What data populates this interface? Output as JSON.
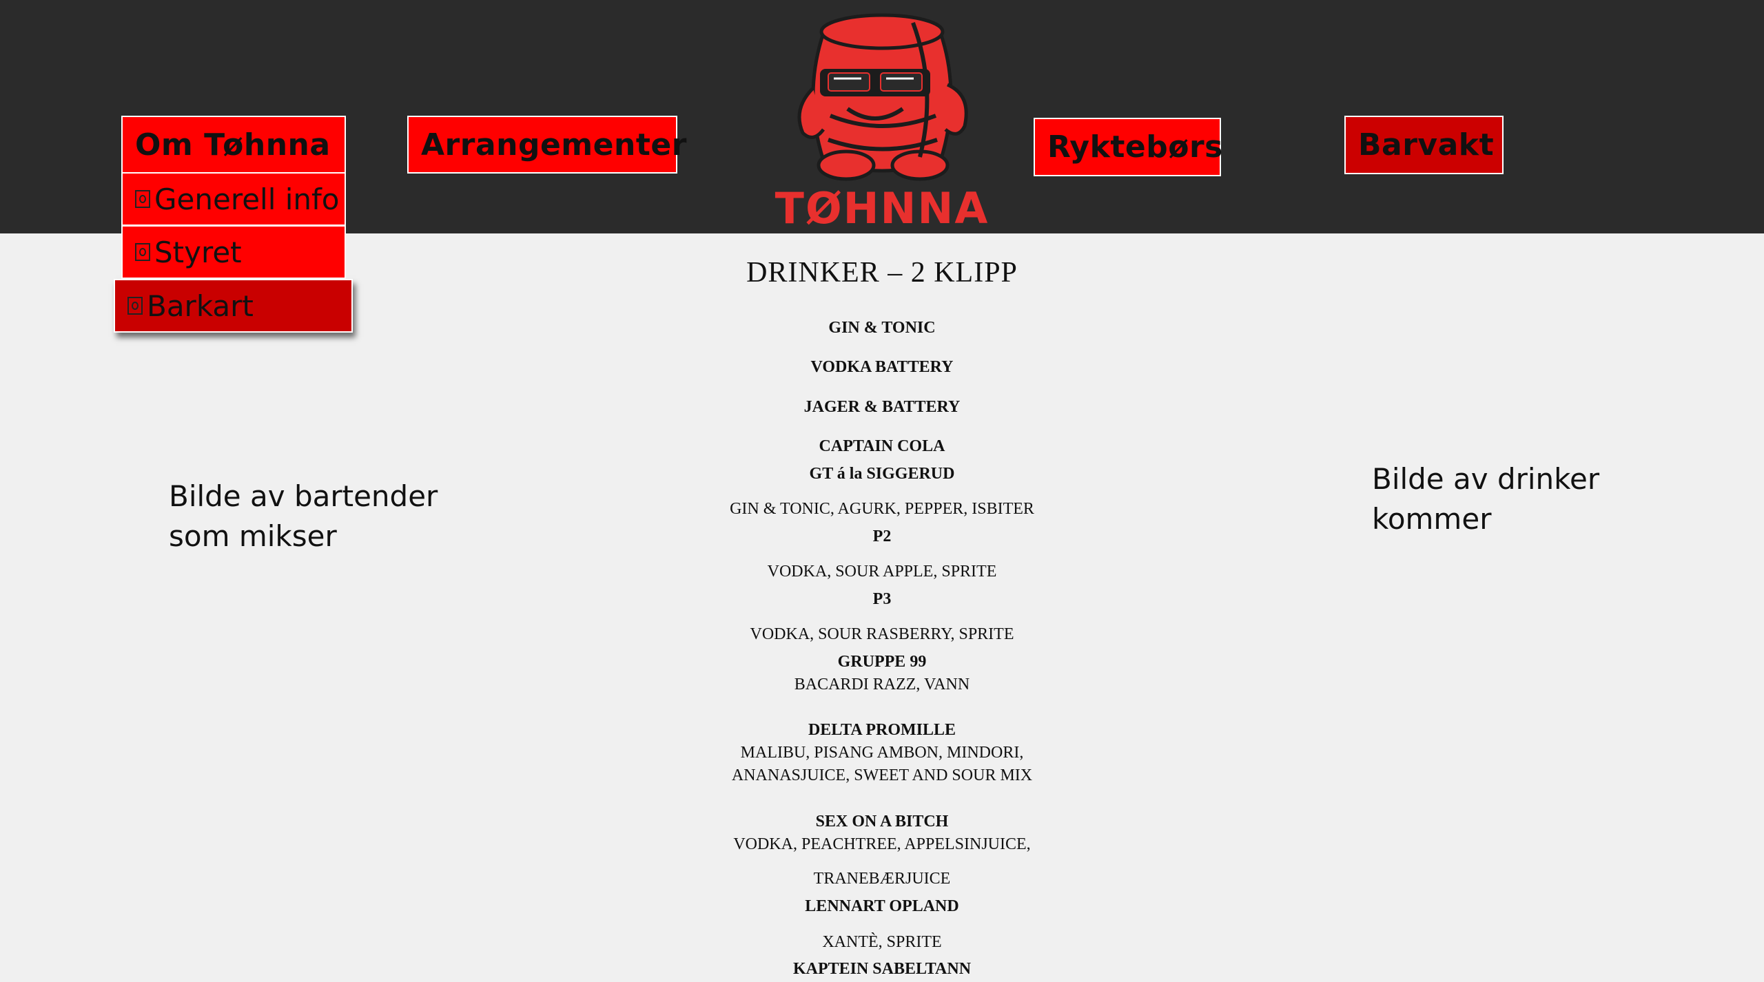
{
  "nav": {
    "om_tohnna": "Om Tøhnna",
    "arrangementer": "Arrangementer",
    "ryktebors": "Ryktebørs",
    "barvakt": "Barvakt"
  },
  "submenu": {
    "generell_info": "Generell info",
    "styret": "Styret",
    "barkart": "Barkart"
  },
  "logo": {
    "text": "TØHNNA",
    "color": "#e8302e"
  },
  "menu": {
    "title": "DRINKER – 2 KLIPP",
    "lines": [
      "GIN & TONIC",
      "VODKA BATTERY",
      "JAGER & BATTERY",
      "CAPTAIN COLA",
      "GT á la SIGGERUD",
      "GIN & TONIC, AGURK, PEPPER, ISBITER",
      "P2",
      "VODKA, SOUR APPLE, SPRITE",
      "P3",
      "VODKA, SOUR RASBERRY, SPRITE",
      "GRUPPE 99",
      "BACARDI RAZZ, VANN",
      "DELTA PROMILLE",
      "MALIBU, PISANG AMBON, MINDORI,",
      "ANANASJUICE, SWEET AND SOUR MIX",
      "SEX ON A BITCH",
      "VODKA, PEACHTREE, APPELSINJUICE,",
      "TRANEBÆRJUICE",
      "LENNART OPLAND",
      "XANTÈ, SPRITE",
      "KAPTEIN SABELTANN"
    ]
  },
  "notes": {
    "left_line1": "Bilde av bartender",
    "left_line2": "som mikser",
    "right_line1": "Bilde av drinker",
    "right_line2": "kommer"
  },
  "colors": {
    "header_bg": "#2b2b2b",
    "button_red": "#ff0000",
    "button_dark_red": "#cc0000",
    "page_bg": "#f0f0f0"
  }
}
